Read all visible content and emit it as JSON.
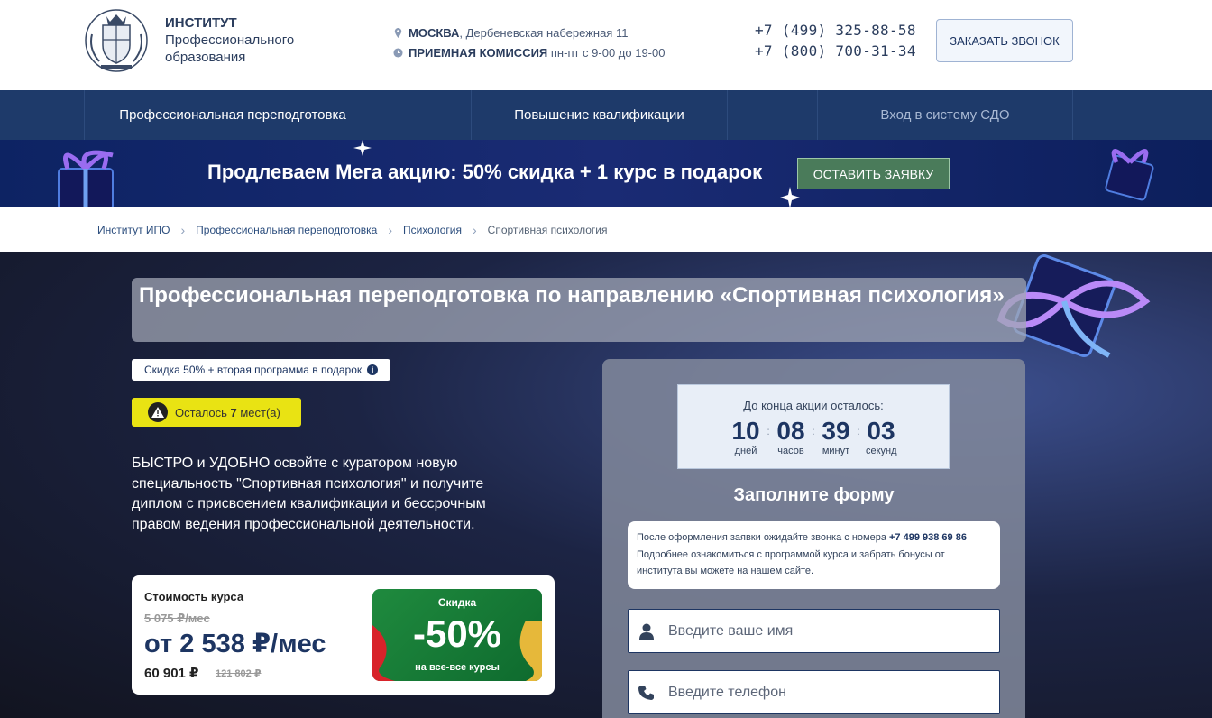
{
  "header": {
    "brand_line1": "ИНСТИТУТ",
    "brand_line2": "Профессионального",
    "brand_line3": "образования",
    "city": "МОСКВА",
    "address": ", Дербеневская набережная 11",
    "admission_label": "ПРИЕМНАЯ КОМИССИЯ",
    "admission_hours": " пн-пт с 9-00 до 19-00",
    "phone1": "+7 (499) 325-88-58",
    "phone2": "+7 (800) 700-31-34",
    "callback_button": "ЗАКАЗАТЬ ЗВОНОК"
  },
  "nav": {
    "item1": "Профессиональная переподготовка",
    "item2": "Повышение квалификации",
    "item3": "Вход в систему СДО"
  },
  "promo": {
    "text": "Продлеваем Мега акцию: 50% скидка + 1 курс в подарок",
    "button": "ОСТАВИТЬ ЗАЯВКУ"
  },
  "breadcrumbs": [
    "Институт ИПО",
    "Профессиональная переподготовка",
    "Психология",
    "Спортивная психология"
  ],
  "hero": {
    "title": "Профессиональная переподготовка по направлению «Спортивная психология»",
    "discount_badge": "Скидка 50% + вторая программа в подарок",
    "seats_prefix": "Осталось ",
    "seats_count": "7",
    "seats_suffix": " мест(а)",
    "description": "БЫСТРО и УДОБНО освойте с куратором новую специальность \"Спортивная психология\" и получите диплом с присвоением квалификации и бессрочным правом ведения профессиональной деятельности."
  },
  "price": {
    "label": "Стоимость курса",
    "old_monthly": "5 075 ₽/мес",
    "monthly": "от 2 538 ₽/мес",
    "full": "60 901 ₽",
    "full_old": "121 802 ₽",
    "sale_title": "Скидка",
    "sale_value": "-50%",
    "sale_caption": "на все-все курсы"
  },
  "form": {
    "timer_label": "До конца акции осталось:",
    "days": "10",
    "days_label": "дней",
    "hours": "08",
    "hours_label": "часов",
    "minutes": "39",
    "minutes_label": "минут",
    "seconds": "03",
    "seconds_label": "секунд",
    "title": "Заполните форму",
    "note_prefix": "После оформления заявки ожидайте звонка с номера ",
    "note_phone": "+7 499 938 69 86",
    "note_rest": "Подробнее ознакомиться с программой курса и забрать бонусы от института вы можете на нашем сайте.",
    "name_placeholder": "Введите ваше имя",
    "phone_placeholder": "Введите телефон"
  },
  "colors": {
    "navy": "#1e3a6a",
    "promo_button": "#4a7b5a",
    "seats_badge": "#e9e313",
    "sale_green": "#1f8a3e"
  }
}
